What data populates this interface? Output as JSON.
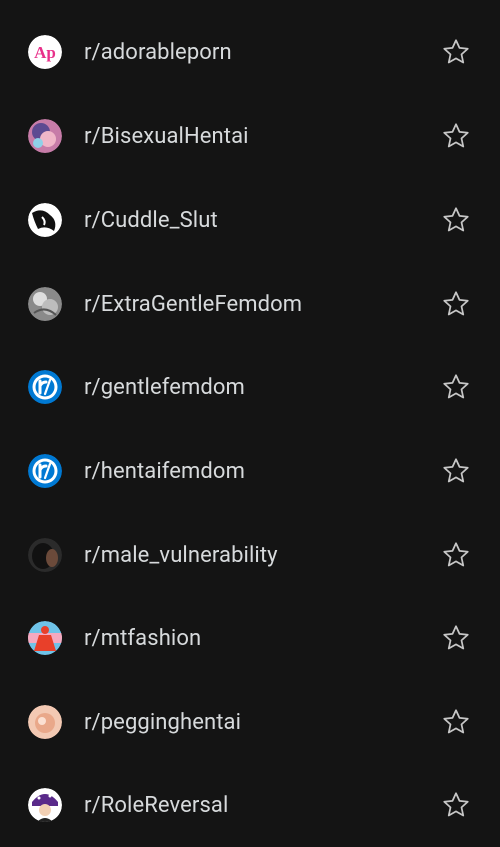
{
  "subreddits": [
    {
      "name": "r/adorableporn",
      "icon": "adorableporn-logo-icon",
      "icon_text": "Ap",
      "bg": "#ffffff",
      "accent": "#e8308a"
    },
    {
      "name": "r/BisexualHentai",
      "icon": "bisexualhentai-avatar-icon",
      "bg": "#c77ca8",
      "accent": "#3a3a8a"
    },
    {
      "name": "r/Cuddle_Slut",
      "icon": "cuddle-slut-avatar-icon",
      "bg": "#ffffff",
      "accent": "#111111"
    },
    {
      "name": "r/ExtraGentleFemdom",
      "icon": "extragentlefemdom-avatar-icon",
      "bg": "#8a8a8a",
      "accent": "#dddddd"
    },
    {
      "name": "r/gentlefemdom",
      "icon": "default-subreddit-icon",
      "bg": "#0079d3",
      "accent": "#ffffff"
    },
    {
      "name": "r/hentaifemdom",
      "icon": "default-subreddit-icon",
      "bg": "#0079d3",
      "accent": "#ffffff"
    },
    {
      "name": "r/male_vulnerability",
      "icon": "male-vulnerability-avatar-icon",
      "bg": "#2b2b2b",
      "accent": "#111111"
    },
    {
      "name": "r/mtfashion",
      "icon": "mtfashion-avatar-icon",
      "bg": "#6fc3e8",
      "accent": "#e8402a"
    },
    {
      "name": "r/pegginghentai",
      "icon": "pegginghentai-avatar-icon",
      "bg": "#f3c9b3",
      "accent": "#e9a88a"
    },
    {
      "name": "r/RoleReversal",
      "icon": "rolereversal-avatar-icon",
      "bg": "#ffffff",
      "accent": "#5a2a8a"
    }
  ],
  "star_icon": "star-outline-icon",
  "colors": {
    "background": "#141414",
    "text": "#d7dadc",
    "star": "#c7c7c7"
  }
}
